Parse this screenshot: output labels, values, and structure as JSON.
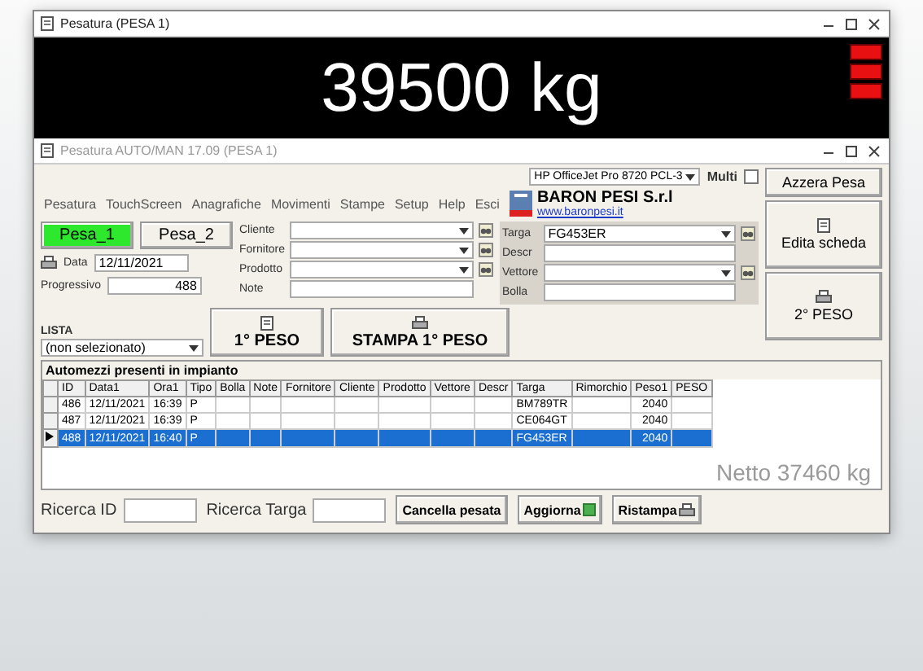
{
  "window": {
    "title": "Pesatura (PESA 1)"
  },
  "display": {
    "reading": "39500 kg",
    "lamps": [
      {
        "on": true
      },
      {
        "on": true
      },
      {
        "on": true
      }
    ]
  },
  "app_window": {
    "title": "Pesatura AUTO/MAN 17.09 (PESA 1)"
  },
  "menu": [
    "Pesatura",
    "TouchScreen",
    "Anagrafiche",
    "Movimenti",
    "Stampe",
    "Setup",
    "Help",
    "Esci"
  ],
  "logo": {
    "company": "BARON PESI S.r.l",
    "url": "www.baronpesi.it"
  },
  "scales": [
    {
      "label": "Pesa_1",
      "selected": true
    },
    {
      "label": "Pesa_2",
      "selected": false
    }
  ],
  "date": {
    "label": "Data",
    "value": "12/11/2021"
  },
  "progressive": {
    "label": "Progressivo",
    "value": "488"
  },
  "left_fields": [
    {
      "label": "Cliente",
      "kind": "combo"
    },
    {
      "label": "Fornitore",
      "kind": "combo"
    },
    {
      "label": "Prodotto",
      "kind": "combo"
    },
    {
      "label": "Note",
      "kind": "text"
    }
  ],
  "right_fields": [
    {
      "label": "Targa",
      "kind": "combo",
      "value": "FG453ER"
    },
    {
      "label": "Descr",
      "kind": "text"
    },
    {
      "label": "Vettore",
      "kind": "combo"
    },
    {
      "label": "Bolla",
      "kind": "text"
    }
  ],
  "printer": {
    "value": "HP OfficeJet Pro 8720 PCL-3"
  },
  "multi": {
    "label": "Multi",
    "checked": false
  },
  "side_buttons": [
    {
      "label": "Azzera Pesa",
      "kind": "plain"
    },
    {
      "label": "Edita scheda",
      "kind": "icon"
    },
    {
      "label": "2° PESO",
      "kind": "icon"
    }
  ],
  "lista": {
    "label": "LISTA",
    "value": "(non selezionato)"
  },
  "action_buttons": [
    "1° PESO",
    "STAMPA 1° PESO"
  ],
  "table": {
    "title": "Automezzi presenti in impianto",
    "columns": [
      "ID",
      "Data1",
      "Ora1",
      "Tipo",
      "Bolla",
      "Note",
      "Fornitore",
      "Cliente",
      "Prodotto",
      "Vettore",
      "Descr",
      "Targa",
      "Rimorchio",
      "Peso1",
      "PESO"
    ],
    "rows": [
      {
        "selected": false,
        "cells": [
          "486",
          "12/11/2021",
          "16:39",
          "P",
          "",
          "",
          "",
          "",
          "",
          "",
          "",
          "BM789TR",
          "",
          "2040",
          ""
        ]
      },
      {
        "selected": false,
        "cells": [
          "487",
          "12/11/2021",
          "16:39",
          "P",
          "",
          "",
          "",
          "",
          "",
          "",
          "",
          "CE064GT",
          "",
          "2040",
          ""
        ]
      },
      {
        "selected": true,
        "cells": [
          "488",
          "12/11/2021",
          "16:40",
          "P",
          "",
          "",
          "",
          "",
          "",
          "",
          "",
          "FG453ER",
          "",
          "2040",
          ""
        ]
      }
    ]
  },
  "net": "Netto 37460 kg",
  "search": [
    {
      "label": "Ricerca ID"
    },
    {
      "label": "Ricerca Targa"
    }
  ],
  "bottom_buttons": [
    {
      "label": "Cancella pesata",
      "kind": "plain"
    },
    {
      "label": "Aggiorna",
      "kind": "icon"
    },
    {
      "label": "Ristampa",
      "kind": "icon"
    }
  ]
}
